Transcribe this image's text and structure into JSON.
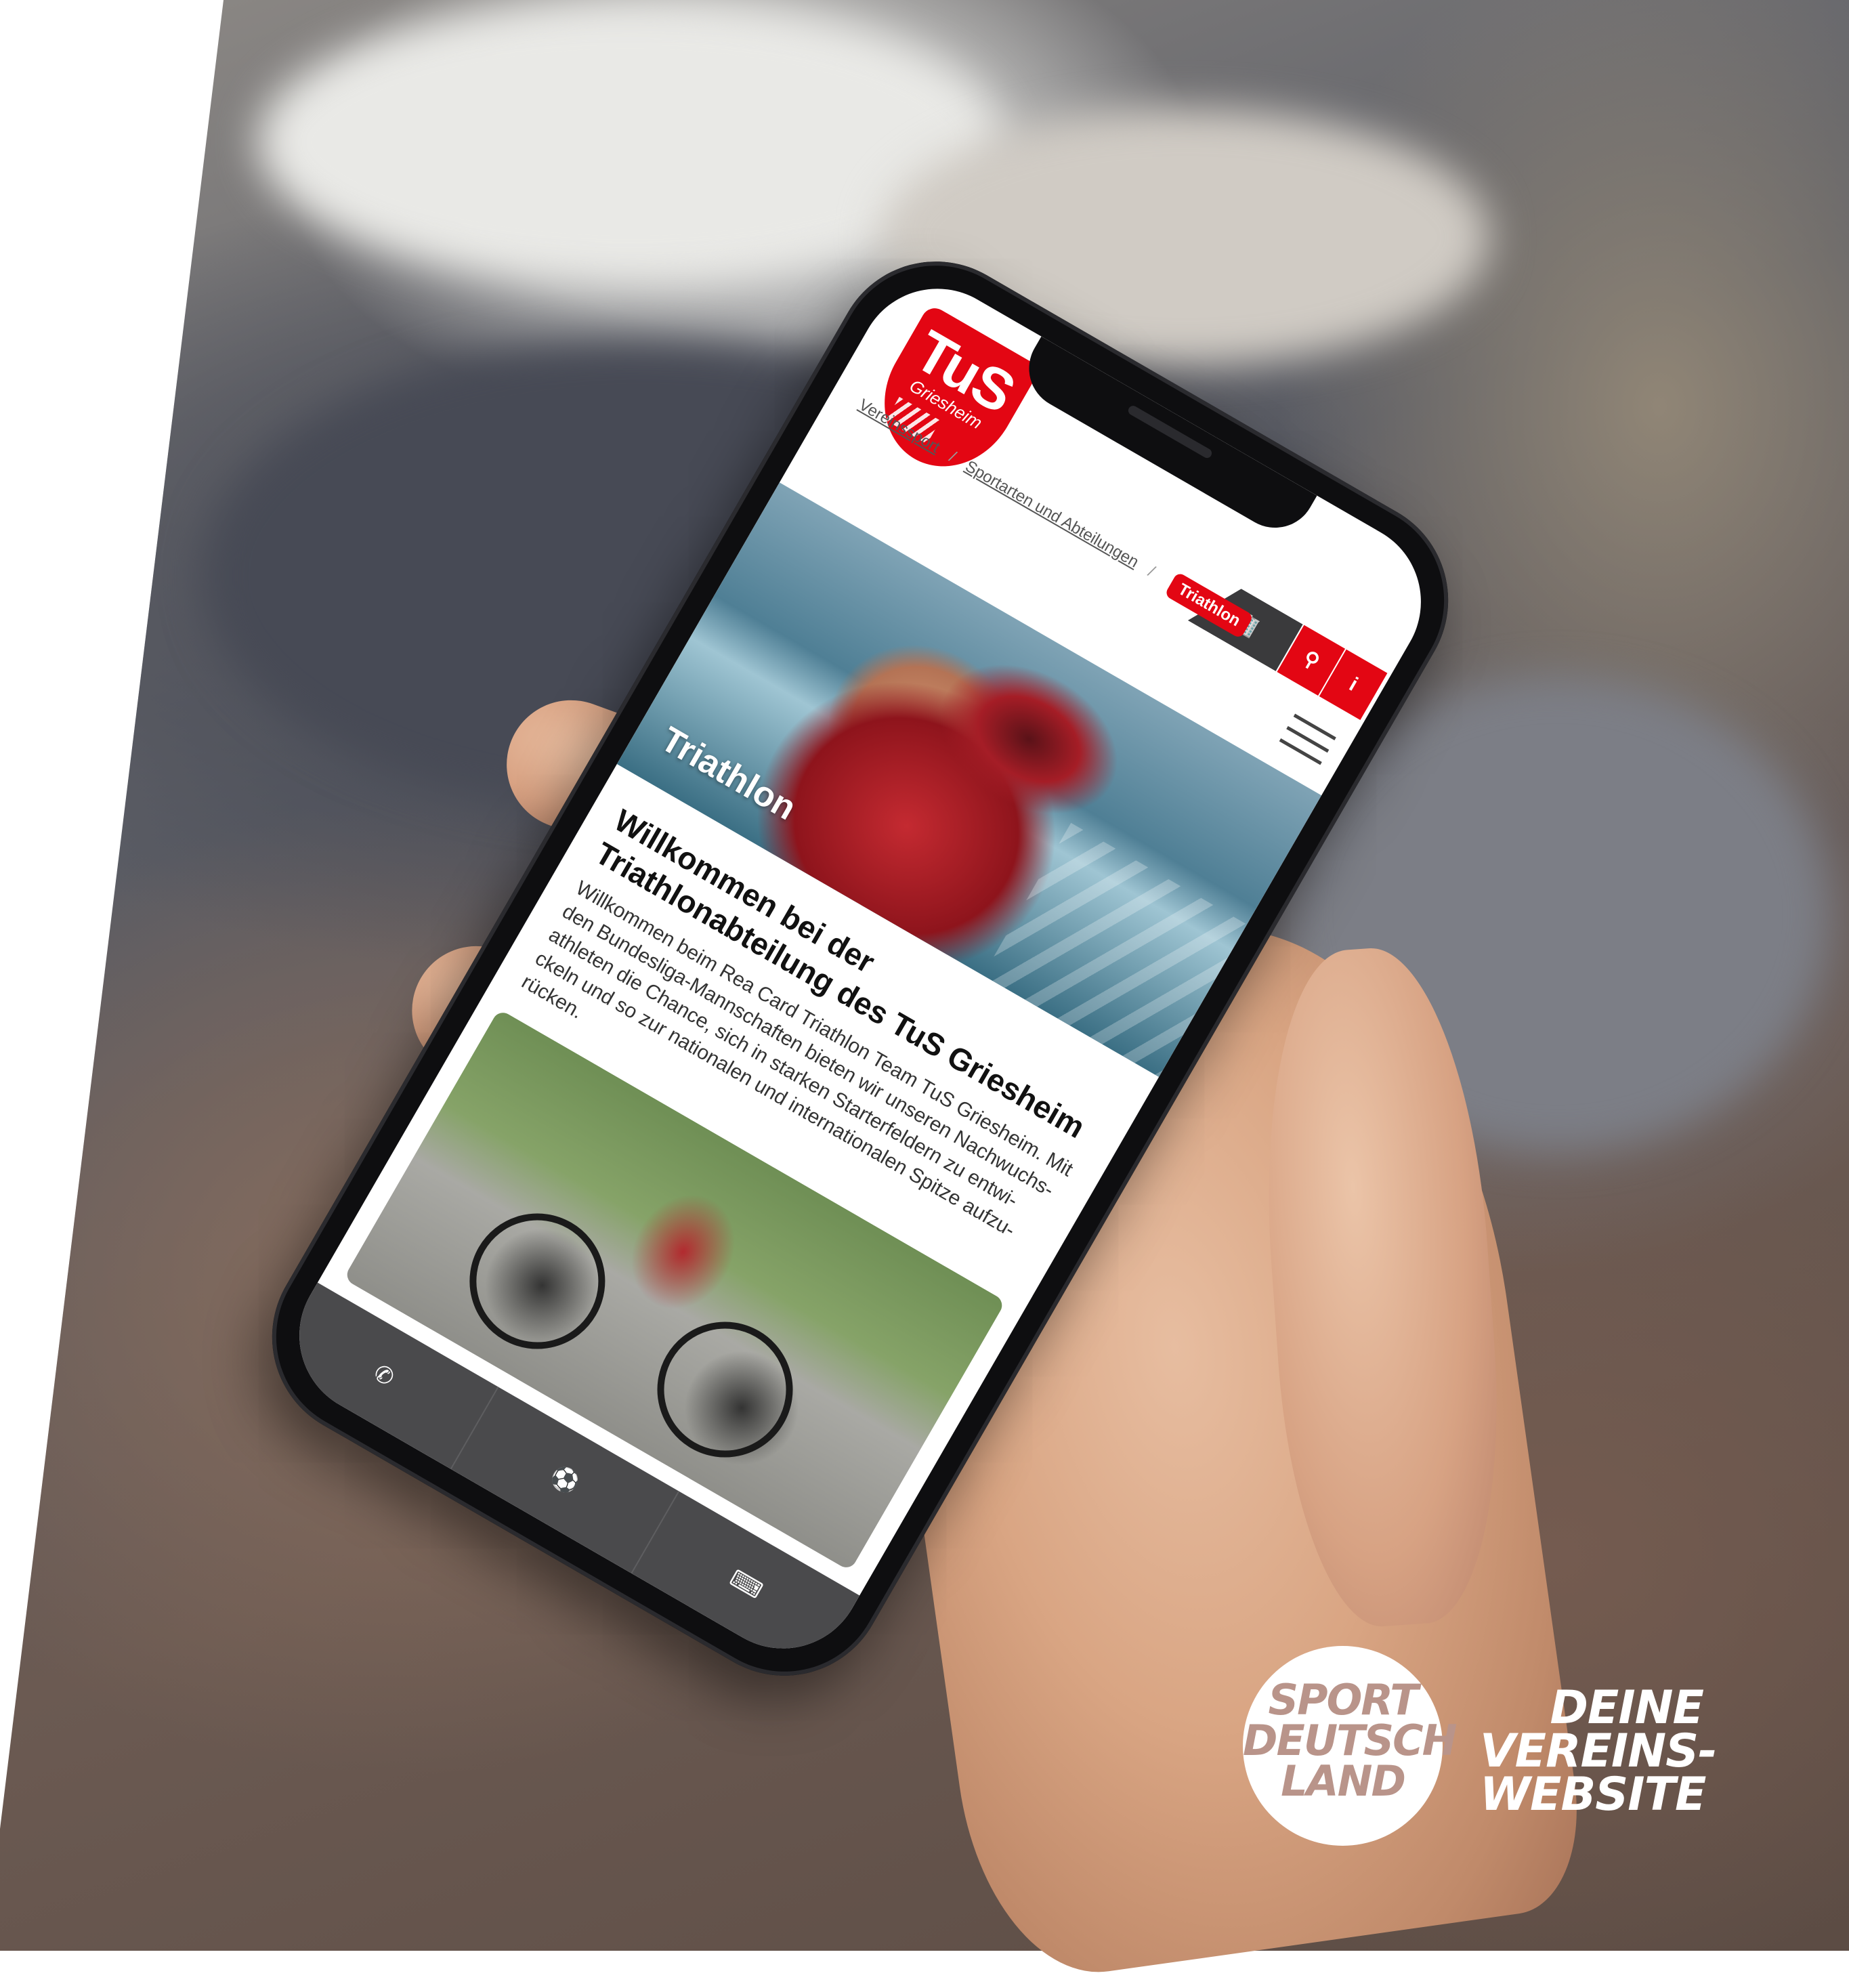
{
  "colors": {
    "brand_red": "#e30613",
    "dark_gray": "#3a3a3c",
    "badge_text": "#b9948a"
  },
  "club_logo": {
    "title": "TuS",
    "subtitle": "Griesheim"
  },
  "toolbar": {
    "building_icon": "building-icon",
    "search_icon": "search-icon",
    "info_icon": "info-icon",
    "menu_icon": "hamburger-icon"
  },
  "breadcrumb": [
    {
      "label": "Vereinssport"
    },
    {
      "label": "Sportarten und Abteilungen"
    },
    {
      "label": "Triathlon",
      "active": true
    }
  ],
  "breadcrumb_separator": "/",
  "hero": {
    "title": "Triathlon"
  },
  "content": {
    "heading": "Willkommen bei der Triathlonabteilung des TuS Griesheim",
    "body": "Willkommen beim Rea Card Triathlon Team TuS Griesheim. Mit den Bundesliga-Mannschaften bieten wir unseren Nachwuchs-athleten die Chance, sich in starken Starterfeldern zu entwi-ckeln und so zur nationalen und internationalen Spitze aufzu-rücken."
  },
  "bottom_bar": [
    {
      "icon": "phone-icon",
      "glyph": "✆"
    },
    {
      "icon": "soccer-ball-icon",
      "glyph": "⚽"
    },
    {
      "icon": "keyboard-icon",
      "glyph": "⌨"
    }
  ],
  "badge": {
    "line1": "SPORT",
    "line2": "DEUTSCH",
    "line3": "LAND"
  },
  "tagline": {
    "line1": "DEINE",
    "line2": "VEREINS-",
    "line3": "WEBSITE"
  }
}
